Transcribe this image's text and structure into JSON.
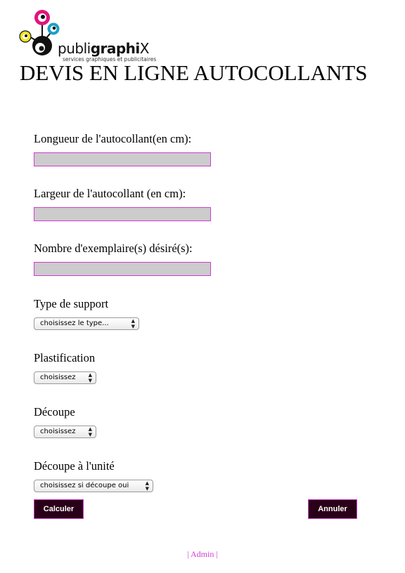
{
  "brand": {
    "name_prefix": "publi",
    "name_bold": "graphi",
    "name_suffix": "X",
    "tagline": "services graphiques et publicitaires",
    "colors": {
      "magenta": "#e0147c",
      "cyan": "#1aa0c8",
      "yellow": "#f0e21a",
      "black": "#111111"
    }
  },
  "page": {
    "title": "DEVIS EN LIGNE AUTOCOLLANTS"
  },
  "form": {
    "longueur_label": "Longueur de l'autocollant(en cm):",
    "longueur_value": "",
    "largeur_label": "Largeur de l'autocollant (en cm):",
    "largeur_value": "",
    "nombre_label": "Nombre d'exemplaire(s) désiré(s):",
    "nombre_value": "",
    "support_label": "Type de support",
    "support_selected": "choisissez le type...",
    "plastification_label": "Plastification",
    "plastification_selected": "choisissez",
    "decoupe_label": "Découpe",
    "decoupe_selected": "choisissez",
    "decoupe_unite_label": "Découpe à l'unité",
    "decoupe_unite_selected": "choisissez si découpe oui",
    "calculer_label": "Calculer",
    "annuler_label": "Annuler"
  },
  "footer": {
    "admin_link": "| Admin |"
  },
  "colors": {
    "input_border": "#d23ad2",
    "input_bg": "#cccccc",
    "button_bg": "#2a0018",
    "link": "#d43ad4"
  }
}
